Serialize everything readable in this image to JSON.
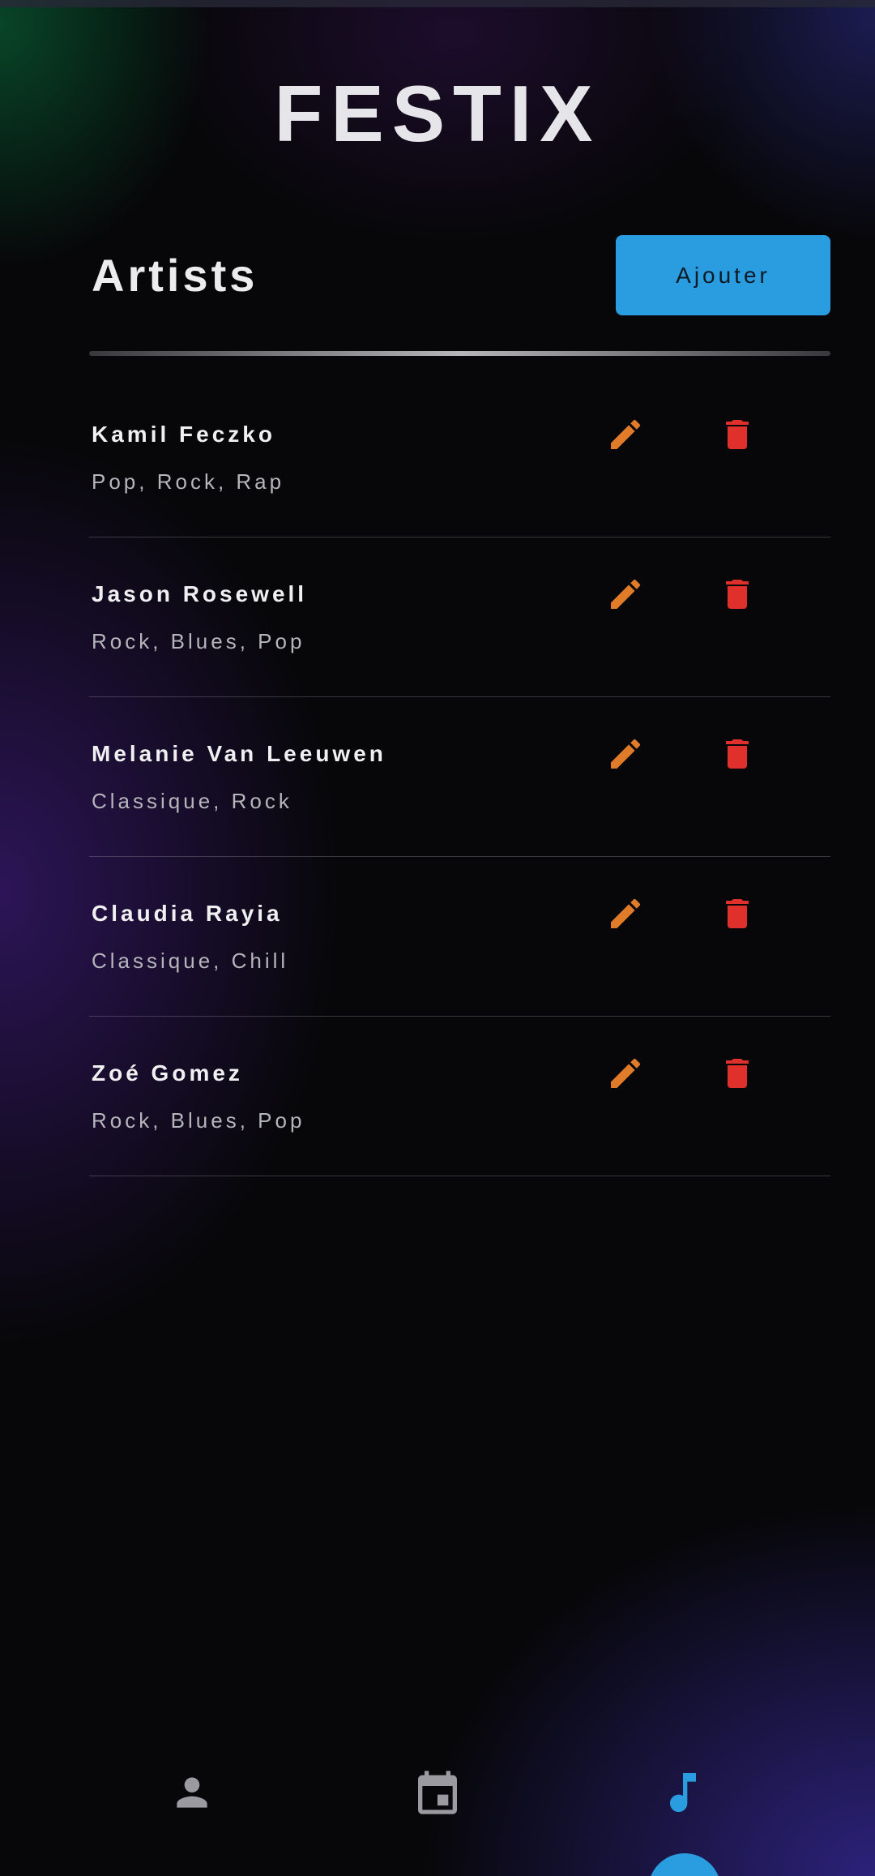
{
  "app": {
    "title": "FESTIX"
  },
  "header": {
    "title": "Artists",
    "add_label": "Ajouter"
  },
  "artists": [
    {
      "name": "Kamil Feczko",
      "genres": "Pop, Rock, Rap"
    },
    {
      "name": "Jason Rosewell",
      "genres": "Rock, Blues, Pop"
    },
    {
      "name": "Melanie Van Leeuwen",
      "genres": "Classique, Rock"
    },
    {
      "name": "Claudia Rayia",
      "genres": "Classique, Chill"
    },
    {
      "name": "Zoé Gomez",
      "genres": "Rock, Blues, Pop"
    }
  ],
  "nav": {
    "items": [
      {
        "icon": "person-icon",
        "active": false
      },
      {
        "icon": "calendar-icon",
        "active": false
      },
      {
        "icon": "music-note-icon",
        "active": true
      }
    ]
  },
  "colors": {
    "accent": "#2a9de0",
    "edit": "#e07b2a",
    "delete": "#e0302c",
    "nav_inactive": "#9a9aa0"
  }
}
